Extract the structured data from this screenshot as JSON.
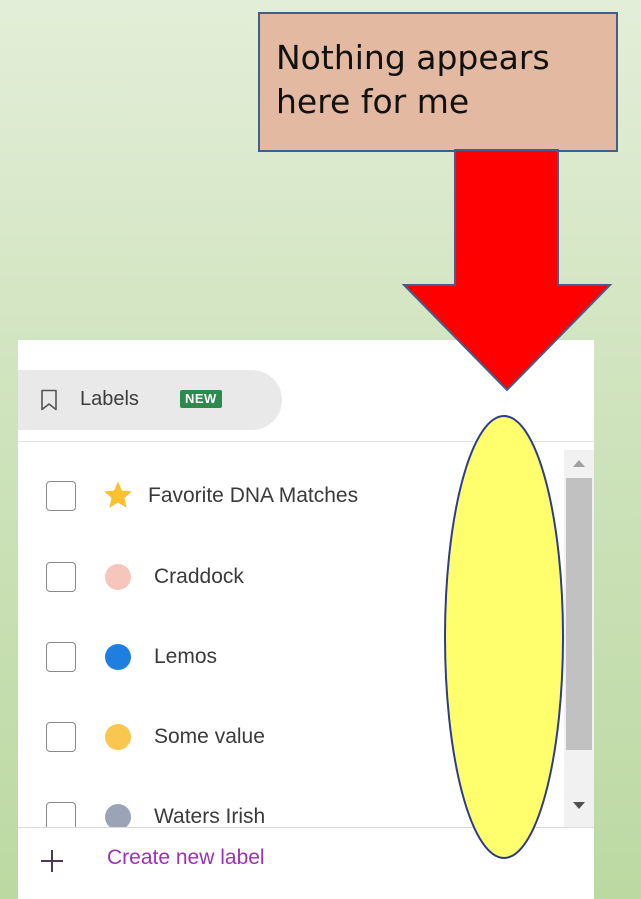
{
  "callout": {
    "lines": [
      "Nothing appears",
      "here for me"
    ]
  },
  "panel": {
    "labels_button": {
      "label": "Labels",
      "badge": "NEW"
    },
    "items": [
      {
        "label": "Favorite DNA Matches",
        "icon": "star-icon",
        "color": "#fbc02d",
        "checked": false
      },
      {
        "label": "Craddock",
        "icon": "dot-icon",
        "color": "#f6c6bd",
        "checked": false
      },
      {
        "label": "Lemos",
        "icon": "dot-icon",
        "color": "#1e7fe0",
        "checked": false
      },
      {
        "label": "Some value",
        "icon": "dot-icon",
        "color": "#f9c74f",
        "checked": false
      },
      {
        "label": "Waters Irish",
        "icon": "dot-icon",
        "color": "#9aa4b6",
        "checked": false
      }
    ],
    "create_label": "Create new label"
  },
  "colors": {
    "arrow": "#ff0000",
    "highlight": "#ffff6e",
    "callout_bg": "#e3b9a1",
    "accent": "#9b32b6",
    "badge": "#2d8a4e"
  }
}
